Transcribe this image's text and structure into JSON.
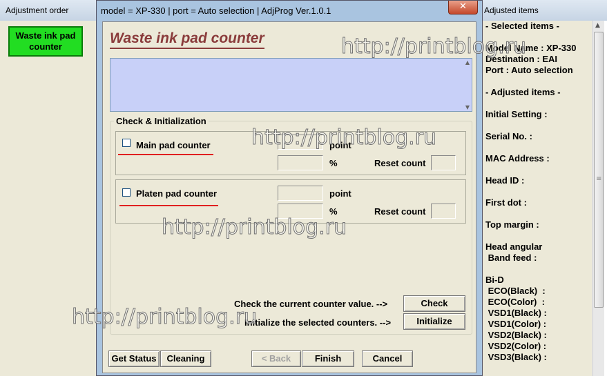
{
  "left_window": {
    "title": "Adjustment order",
    "button_label": "Waste ink pad counter"
  },
  "dialog": {
    "title": "model = XP-330 | port = Auto selection | AdjProg Ver.1.0.1",
    "close_glyph": "✕",
    "heading": "Waste ink pad counter",
    "group_title": "Check & Initialization",
    "main_pad": {
      "label": "Main pad counter",
      "point_label": "point",
      "percent_label": "%",
      "reset_label": "Reset count",
      "checked": false
    },
    "platen_pad": {
      "label": "Platen pad counter",
      "point_label": "point",
      "percent_label": "%",
      "reset_label": "Reset count",
      "checked": false
    },
    "check_prompt": "Check the current counter value. -->",
    "check_button": "Check",
    "init_prompt": "Initialize the selected counters. -->",
    "init_button": "Initialize",
    "footer": {
      "get_status": "Get Status",
      "cleaning": "Cleaning",
      "back": "< Back",
      "finish": "Finish",
      "cancel": "Cancel"
    }
  },
  "right_window": {
    "title": "Adjusted items",
    "lines": [
      "- Selected items -",
      "Model Name : XP-330",
      "Destination : EAI",
      "Port : Auto selection",
      "- Adjusted items -",
      "Initial Setting :",
      "Serial No. :",
      "MAC Address :",
      "Head ID :",
      "First dot :",
      "Top margin :",
      "Head angular",
      " Band feed :",
      "Bi-D",
      " ECO(Black)  :",
      " ECO(Color)  :",
      " VSD1(Black) :",
      " VSD1(Color) :",
      " VSD2(Black) :",
      " VSD2(Color) :",
      " VSD3(Black) :"
    ]
  },
  "watermark": "http://printblog.ru",
  "colors": {
    "heading": "#8a3b3b",
    "green_button": "#22dd22",
    "textarea": "#c8d0f8",
    "underline": "#e02020"
  }
}
